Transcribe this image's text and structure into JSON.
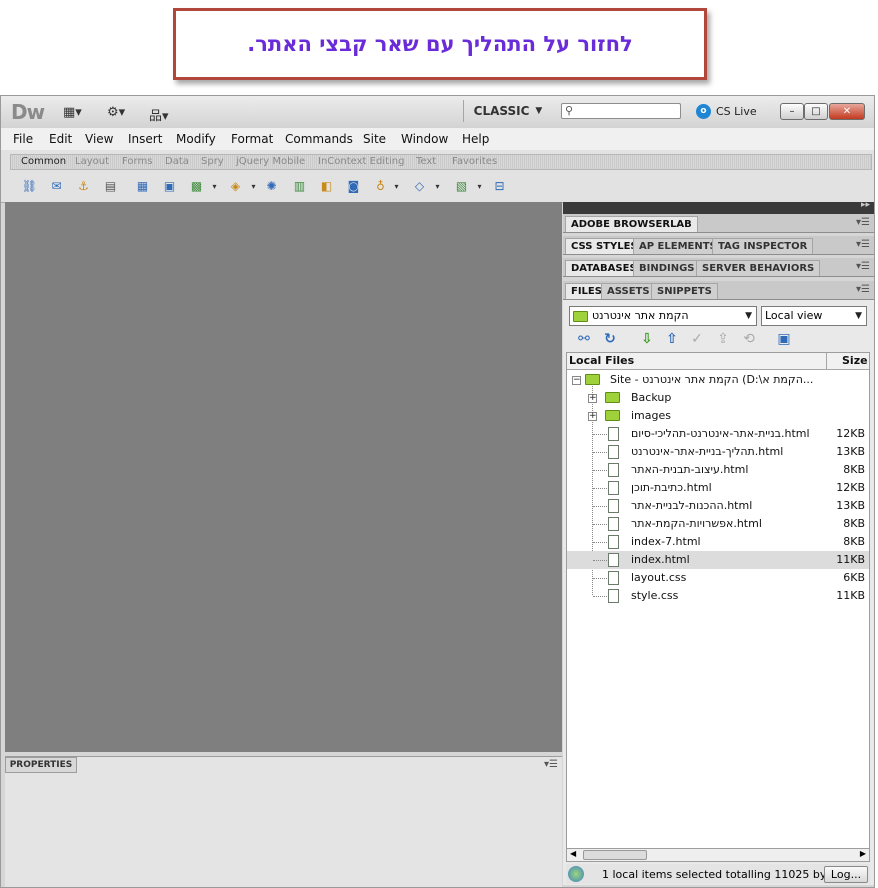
{
  "callout": {
    "text": "לחזור על התהליך עם שאר קבצי האתר."
  },
  "app": {
    "logo": "Dw",
    "layout_label": "CLASSIC",
    "cs_live": "CS Live",
    "window_buttons": {
      "minimize": "–",
      "maximize": "□",
      "close": "✕"
    }
  },
  "menu": [
    "File",
    "Edit",
    "View",
    "Insert",
    "Modify",
    "Format",
    "Commands",
    "Site",
    "Window",
    "Help"
  ],
  "insert_tabs": [
    "Common",
    "Layout",
    "Forms",
    "Data",
    "Spry",
    "jQuery Mobile",
    "InContext Editing",
    "Text",
    "Favorites"
  ],
  "properties": {
    "label": "PROPERTIES"
  },
  "panels": {
    "browserlab": [
      "ADOBE BROWSERLAB"
    ],
    "css": [
      "CSS STYLES",
      "AP ELEMENTS",
      "TAG INSPECTOR"
    ],
    "db": [
      "DATABASES",
      "BINDINGS",
      "SERVER BEHAVIORS"
    ],
    "files": [
      "FILES",
      "ASSETS",
      "SNIPPETS"
    ]
  },
  "files": {
    "site_name": "הקמת אתר אינטרנט",
    "view": "Local view",
    "col_local": "Local Files",
    "col_size": "Size",
    "root": "Site - הקמת אתר אינטרנט (D:\\הקמת א...",
    "folders": [
      "Backup",
      "images"
    ],
    "items": [
      {
        "name": "בניית-אתר-אינטרנט-תהליכי-סיום.html",
        "size": "12KB"
      },
      {
        "name": "תהליך-בניית-אתר-אינטרנט.html",
        "size": "13KB"
      },
      {
        "name": "עיצוב-תבנית-האתר.html",
        "size": "8KB"
      },
      {
        "name": "כתיבת-תוכן.html",
        "size": "12KB"
      },
      {
        "name": "ההכנות-לבניית-אתר.html",
        "size": "13KB"
      },
      {
        "name": "אפשרויות-הקמת-אתר.html",
        "size": "8KB"
      },
      {
        "name": "index-7.html",
        "size": "8KB"
      },
      {
        "name": "index.html",
        "size": "11KB"
      },
      {
        "name": "layout.css",
        "size": "6KB"
      },
      {
        "name": "style.css",
        "size": "11KB"
      }
    ],
    "selected_index": 7,
    "status": "1 local items selected totalling 11025 by",
    "log_button": "Log..."
  }
}
